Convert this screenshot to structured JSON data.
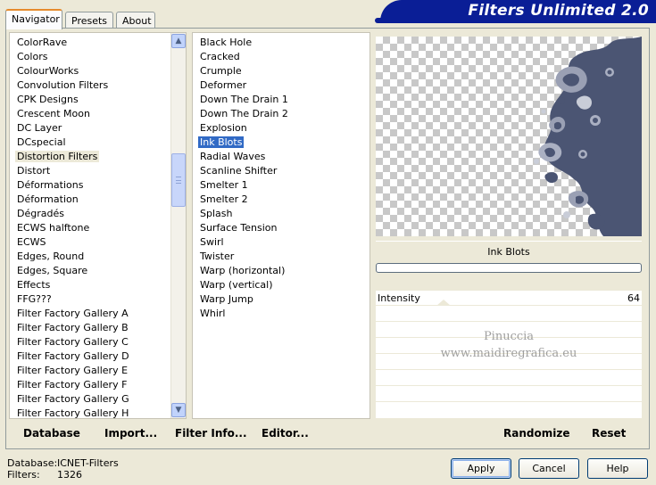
{
  "tabs": [
    "Navigator",
    "Presets",
    "About"
  ],
  "banner_title": "Filters Unlimited 2.0",
  "categories": [
    "ColorRave",
    "Colors",
    "ColourWorks",
    "Convolution Filters",
    "CPK Designs",
    "Crescent Moon",
    "DC Layer",
    "DCspecial",
    "Distortion Filters",
    "Distort",
    "Déformations",
    "Déformation",
    "Dégradés",
    "ECWS halftone",
    "ECWS",
    "Edges, Round",
    "Edges, Square",
    "Effects",
    "FFG???",
    "Filter Factory Gallery A",
    "Filter Factory Gallery B",
    "Filter Factory Gallery C",
    "Filter Factory Gallery D",
    "Filter Factory Gallery E",
    "Filter Factory Gallery F",
    "Filter Factory Gallery G",
    "Filter Factory Gallery H"
  ],
  "selected_category": "Distortion Filters",
  "filters": [
    "Black Hole",
    "Cracked",
    "Crumple",
    "Deformer",
    "Down The Drain 1",
    "Down The Drain 2",
    "Explosion",
    "Ink Blots",
    "Radial Waves",
    "Scanline Shifter",
    "Smelter 1",
    "Smelter 2",
    "Splash",
    "Surface Tension",
    "Swirl",
    "Twister",
    "Warp (horizontal)",
    "Warp (vertical)",
    "Warp Jump",
    "Whirl"
  ],
  "selected_filter": "Ink Blots",
  "preview": {
    "filter_name": "Ink Blots",
    "blob_color": "#4b5573"
  },
  "slider": {
    "label": "Intensity",
    "value": "64",
    "value_fraction": 0.2
  },
  "watermark": {
    "line1": "Pinuccia",
    "line2": "www.maidiregrafica.eu"
  },
  "left_actions": {
    "database": "Database",
    "import": "Import...",
    "filter_info": "Filter Info...",
    "editor": "Editor..."
  },
  "right_actions": {
    "randomize": "Randomize",
    "reset": "Reset"
  },
  "footer": {
    "db_label": "Database:",
    "db_value": "ICNET-Filters",
    "filters_label": "Filters:",
    "filters_value": "1326"
  },
  "buttons": {
    "apply": "Apply",
    "cancel": "Cancel",
    "help": "Help"
  }
}
